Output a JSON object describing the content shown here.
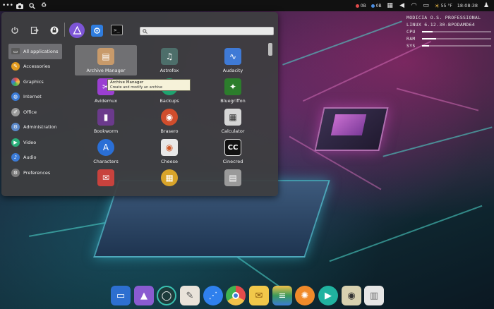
{
  "top_panel": {
    "left_icons": [
      "dots-icon",
      "camera-icon",
      "search-icon",
      "recycle-icon"
    ],
    "stats": [
      {
        "label": "0B",
        "color": "#e24b4b"
      },
      {
        "label": "0B",
        "color": "#4b8ee2"
      }
    ],
    "weather": "55 °F",
    "clock": "18:08:38"
  },
  "conky": {
    "title": "MODICIA O.S. PROFESSIONAL",
    "kernel": "LINUX 6.12.30-BPODAMD64",
    "rows": [
      {
        "label": "CPU",
        "level": 0.15
      },
      {
        "label": "RAM",
        "level": 0.2
      },
      {
        "label": "SYS",
        "level": 0.1
      }
    ]
  },
  "menu": {
    "search_placeholder": "",
    "categories": [
      {
        "label": "All applications",
        "icon": "monitor-icon",
        "color": "#5a5a5a",
        "active": true
      },
      {
        "label": "Accessories",
        "icon": "accessories-icon",
        "color": "#e39c1f"
      },
      {
        "label": "Graphics",
        "icon": "graphics-icon",
        "color": "#e8e8e8"
      },
      {
        "label": "Internet",
        "icon": "globe-icon",
        "color": "#3b7bd6"
      },
      {
        "label": "Office",
        "icon": "office-icon",
        "color": "#9a9a9a"
      },
      {
        "label": "Administration",
        "icon": "administration-icon",
        "color": "#5b88c9"
      },
      {
        "label": "Video",
        "icon": "video-icon",
        "color": "#2ab07a"
      },
      {
        "label": "Audio",
        "icon": "audio-icon",
        "color": "#3b7bd6"
      },
      {
        "label": "Preferences",
        "icon": "preferences-icon",
        "color": "#7b7b7b"
      }
    ],
    "apps": [
      {
        "label": "Archive Manager",
        "icon": "archive-icon",
        "color": "#c89a6a",
        "active": true
      },
      {
        "label": "Astrofox",
        "icon": "astrofox-icon",
        "color": "#4d6e6a"
      },
      {
        "label": "Audacity",
        "icon": "audacity-icon",
        "color": "#3f7ad6"
      },
      {
        "label": "Avidemux",
        "icon": "avidemux-icon",
        "color": "#9b3fd1"
      },
      {
        "label": "Backups",
        "icon": "backups-icon",
        "color": "#1fa36f"
      },
      {
        "label": "Bluegriffon",
        "icon": "bluegriffon-icon",
        "color": "#2c7d2c"
      },
      {
        "label": "Bookworm",
        "icon": "bookworm-icon",
        "color": "#6b3a8c"
      },
      {
        "label": "Brasero",
        "icon": "brasero-icon",
        "color": "#d04d2c"
      },
      {
        "label": "Calculator",
        "icon": "calculator-icon",
        "color": "#d6d6d6"
      },
      {
        "label": "Characters",
        "icon": "characters-icon",
        "color": "#2a6fd6"
      },
      {
        "label": "Cheese",
        "icon": "cheese-icon",
        "color": "#e8e8e8"
      },
      {
        "label": "Cinecred",
        "icon": "cinecred-icon",
        "color": "#111111"
      },
      {
        "label": "",
        "icon": "mail-app-icon",
        "color": "#c8423d"
      },
      {
        "label": "",
        "icon": "film-app-icon",
        "color": "#d8a42a"
      },
      {
        "label": "",
        "icon": "files-app-icon",
        "color": "#9a9a9a"
      }
    ],
    "tooltip": {
      "title": "Archive Manager",
      "description": "Create and modify an archive"
    }
  },
  "dock": [
    {
      "icon": "files-icon",
      "color": "#2d6fd0"
    },
    {
      "icon": "app-store-icon",
      "color": "#8a5bd1"
    },
    {
      "icon": "terminal-icon",
      "color": "#1d3b3b"
    },
    {
      "icon": "text-editor-icon",
      "color": "#e9e3da"
    },
    {
      "icon": "share-icon",
      "color": "#2f80ed"
    },
    {
      "icon": "chrome-icon",
      "color": "#e0e0e0"
    },
    {
      "icon": "mail-icon",
      "color": "#f1c84a"
    },
    {
      "icon": "layers-icon",
      "color": "#3a9a5a"
    },
    {
      "icon": "image-viewer-icon",
      "color": "#f08a2a"
    },
    {
      "icon": "media-player-icon",
      "color": "#20b2a0"
    },
    {
      "icon": "speaker-icon",
      "color": "#d8d1b0"
    },
    {
      "icon": "trash-icon",
      "color": "#e6e6e6"
    }
  ]
}
